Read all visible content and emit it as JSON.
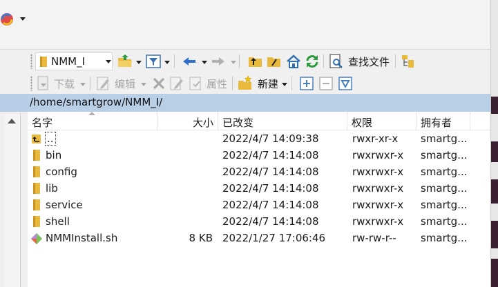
{
  "toolbar1": {
    "current_dir": "NMM_I"
  },
  "toolbar2": {
    "download_label": "下载",
    "edit_label": "编辑",
    "properties_label": "属性",
    "new_label": "新建",
    "find_files_label": "查找文件"
  },
  "path": "/home/smartgrow/NMM_I/",
  "columns": {
    "name": "名字",
    "size": "大小",
    "modified": "已改变",
    "permissions": "权限",
    "owner": "拥有者"
  },
  "files": [
    {
      "name": "..",
      "type": "parent",
      "size": "",
      "modified": "2022/4/7 14:09:38",
      "permissions": "rwxr-xr-x",
      "owner": "smartg..."
    },
    {
      "name": "bin",
      "type": "folder",
      "size": "",
      "modified": "2022/4/7 14:14:08",
      "permissions": "rwxrwxr-x",
      "owner": "smartg..."
    },
    {
      "name": "config",
      "type": "folder",
      "size": "",
      "modified": "2022/4/7 14:14:08",
      "permissions": "rwxrwxr-x",
      "owner": "smartg..."
    },
    {
      "name": "lib",
      "type": "folder",
      "size": "",
      "modified": "2022/4/7 14:14:08",
      "permissions": "rwxrwxr-x",
      "owner": "smartg..."
    },
    {
      "name": "service",
      "type": "folder",
      "size": "",
      "modified": "2022/4/7 14:14:08",
      "permissions": "rwxrwxr-x",
      "owner": "smartg..."
    },
    {
      "name": "shell",
      "type": "folder",
      "size": "",
      "modified": "2022/4/7 14:14:08",
      "permissions": "rwxrwxr-x",
      "owner": "smartg..."
    },
    {
      "name": "NMMInstall.sh",
      "type": "file",
      "size": "8 KB",
      "modified": "2022/1/27 17:06:46",
      "permissions": "rw-rw-r--",
      "owner": "smartg..."
    }
  ]
}
